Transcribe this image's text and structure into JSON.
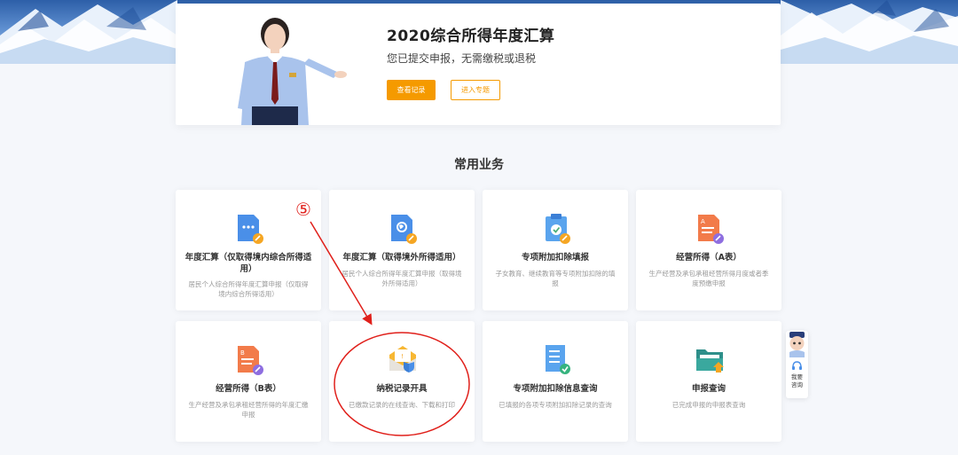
{
  "hero": {
    "title": "2020综合所得年度汇算",
    "subtitle": "您已提交申报，无需缴税或退税",
    "view_record_button": "查看记录",
    "enter_topic_button": "进入专题"
  },
  "section": {
    "title": "常用业务"
  },
  "services": [
    {
      "title": "年度汇算（仅取得境内综合所得适用）",
      "desc": "居民个人综合所得年度汇算申报（仅取得境内综合所得适用）",
      "icon": "doc-domestic-icon"
    },
    {
      "title": "年度汇算（取得境外所得适用）",
      "desc": "居民个人综合所得年度汇算申报（取得境外所得适用）",
      "icon": "doc-globe-icon"
    },
    {
      "title": "专项附加扣除填报",
      "desc": "子女教育、继续教育等专项附加扣除的填报",
      "icon": "clipboard-check-icon"
    },
    {
      "title": "经营所得（A表）",
      "desc": "生产经营及承包承租经营所得月度或者季度预缴申报",
      "icon": "doc-a-icon"
    },
    {
      "title": "经营所得（B表）",
      "desc": "生产经营及承包承租经营所得的年度汇缴申报",
      "icon": "doc-b-icon"
    },
    {
      "title": "纳税记录开具",
      "desc": "已缴款记录的在线查询、下载和打印",
      "icon": "envelope-shield-icon"
    },
    {
      "title": "专项附加扣除信息查询",
      "desc": "已填报的各项专项附加扣除记录的查询",
      "icon": "list-check-icon"
    },
    {
      "title": "申报查询",
      "desc": "已完成申报的申报表查询",
      "icon": "folder-upload-icon"
    }
  ],
  "annotation": {
    "step_marker": "⑤"
  },
  "helper": {
    "label_line1": "我要",
    "label_line2": "咨询"
  },
  "colors": {
    "accent": "#f59a00",
    "annotation": "#e0201b",
    "banner": "#2d5fa8"
  }
}
